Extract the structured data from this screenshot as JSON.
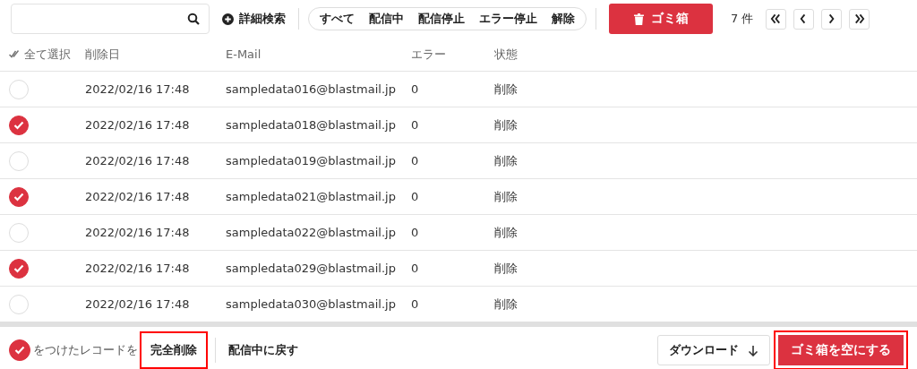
{
  "toolbar": {
    "advanced_search": "詳細検索",
    "filters": [
      {
        "label": "すべて",
        "selected": false
      },
      {
        "label": "配信中",
        "selected": false
      },
      {
        "label": "配信停止",
        "selected": false
      },
      {
        "label": "エラー停止",
        "selected": false
      },
      {
        "label": "解除",
        "selected": false
      }
    ],
    "trash_button": "ゴミ箱",
    "count": "7 件"
  },
  "table": {
    "columns": [
      "全て選択",
      "削除日",
      "E-Mail",
      "エラー",
      "状態"
    ],
    "rows": [
      {
        "checked": false,
        "date": "2022/02/16 17:48",
        "email": "sampledata016@blastmail.jp",
        "errors": "0",
        "status": "削除"
      },
      {
        "checked": true,
        "date": "2022/02/16 17:48",
        "email": "sampledata018@blastmail.jp",
        "errors": "0",
        "status": "削除"
      },
      {
        "checked": false,
        "date": "2022/02/16 17:48",
        "email": "sampledata019@blastmail.jp",
        "errors": "0",
        "status": "削除"
      },
      {
        "checked": true,
        "date": "2022/02/16 17:48",
        "email": "sampledata021@blastmail.jp",
        "errors": "0",
        "status": "削除"
      },
      {
        "checked": false,
        "date": "2022/02/16 17:48",
        "email": "sampledata022@blastmail.jp",
        "errors": "0",
        "status": "削除"
      },
      {
        "checked": true,
        "date": "2022/02/16 17:48",
        "email": "sampledata029@blastmail.jp",
        "errors": "0",
        "status": "削除"
      },
      {
        "checked": false,
        "date": "2022/02/16 17:48",
        "email": "sampledata030@blastmail.jp",
        "errors": "0",
        "status": "削除"
      }
    ]
  },
  "footer": {
    "label": "をつけたレコードを",
    "actions": [
      {
        "label": "完全削除",
        "highlighted": true
      },
      {
        "label": "配信中に戻す",
        "highlighted": false
      }
    ],
    "download": "ダウンロード",
    "empty_trash": {
      "label": "ゴミ箱を空にする",
      "highlighted": true
    }
  }
}
